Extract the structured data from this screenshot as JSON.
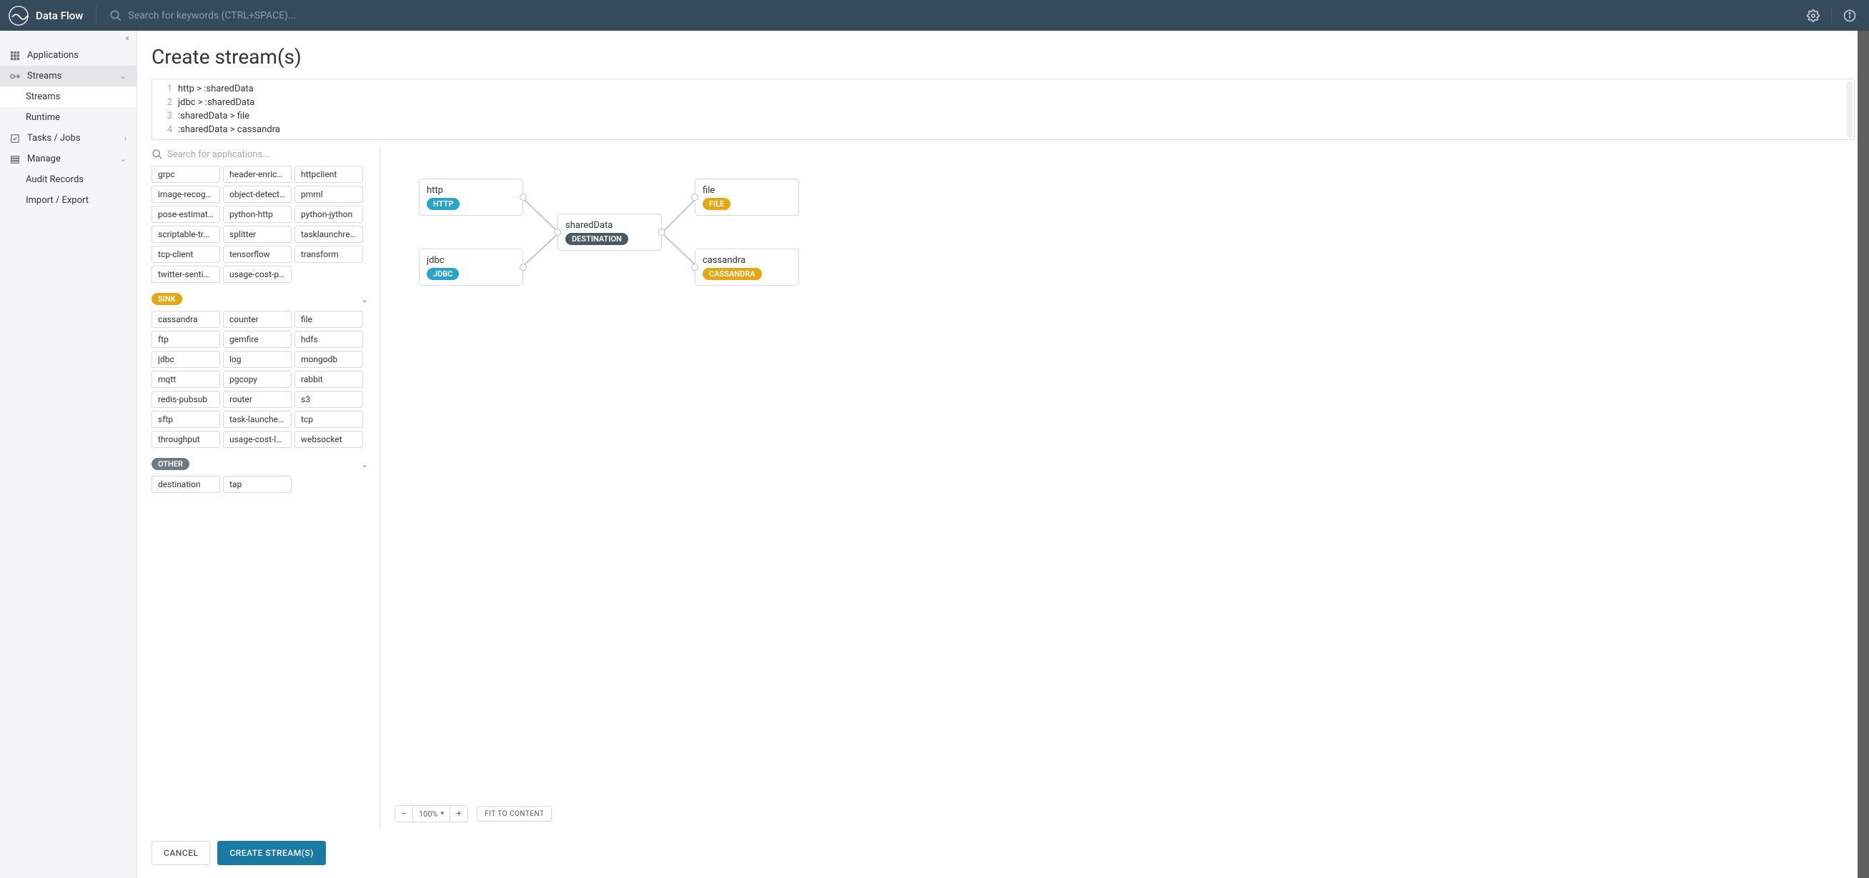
{
  "app": {
    "name": "Data Flow"
  },
  "topsearch": {
    "placeholder": "Search for keywords (CTRL+SPACE)..."
  },
  "nav": {
    "applications": "Applications",
    "streams": "Streams",
    "streams_sub": "Streams",
    "runtime_sub": "Runtime",
    "tasks": "Tasks / Jobs",
    "manage": "Manage",
    "audit": "Audit Records",
    "importexport": "Import / Export"
  },
  "page": {
    "title": "Create stream(s)"
  },
  "dsl": {
    "lines": [
      "http > :sharedData",
      "jdbc > :sharedData",
      ":sharedData > file",
      ":sharedData > cassandra"
    ]
  },
  "appsearch": {
    "placeholder": "Search for applications..."
  },
  "processor_chips": [
    "grpc",
    "header-enricher",
    "httpclient",
    "image-recogniti…",
    "object-detection",
    "pmml",
    "pose-estimation",
    "python-http",
    "python-jython",
    "scriptable-transf…",
    "splitter",
    "tasklaunchreque…",
    "tcp-client",
    "tensorflow",
    "transform",
    "twitter-sentiment",
    "usage-cost-proc…"
  ],
  "sections": {
    "sink": "SINK",
    "other": "OTHER"
  },
  "sink_chips": [
    "cassandra",
    "counter",
    "file",
    "ftp",
    "gemfire",
    "hdfs",
    "jdbc",
    "log",
    "mongodb",
    "mqtt",
    "pgcopy",
    "rabbit",
    "redis-pubsub",
    "router",
    "s3",
    "sftp",
    "task-launcher-d…",
    "tcp",
    "throughput",
    "usage-cost-logg…",
    "websocket"
  ],
  "other_chips": [
    "destination",
    "tap"
  ],
  "nodes": {
    "http": {
      "title": "http",
      "badge": "HTTP"
    },
    "jdbc": {
      "title": "jdbc",
      "badge": "JDBC"
    },
    "shared": {
      "title": "sharedData",
      "badge": "DESTINATION"
    },
    "file": {
      "title": "file",
      "badge": "FILE"
    },
    "cassandra": {
      "title": "cassandra",
      "badge": "CASSANDRA"
    }
  },
  "zoom": {
    "value": "100%",
    "fit": "FIT TO CONTENT"
  },
  "footer": {
    "cancel": "CANCEL",
    "create": "CREATE STREAM(S)"
  }
}
